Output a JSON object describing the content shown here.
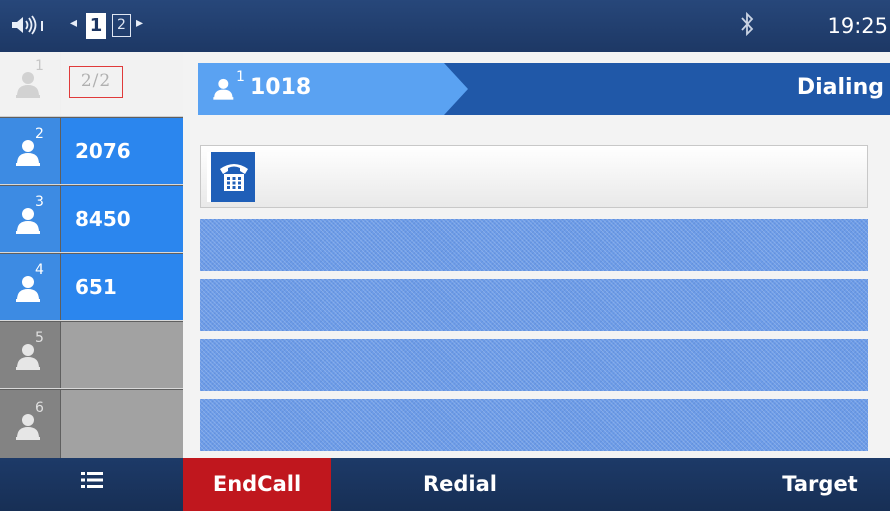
{
  "status_bar": {
    "page_current": "1",
    "page_next": "2",
    "clock": "19:25",
    "icons": [
      "volume-icon",
      "page-prev-icon",
      "page-next-icon",
      "bluetooth-icon"
    ]
  },
  "lines": {
    "counter": "2/2",
    "items": [
      {
        "index": "1",
        "number": "",
        "state": "idle"
      },
      {
        "index": "2",
        "number": "2076",
        "state": "active"
      },
      {
        "index": "3",
        "number": "8450",
        "state": "active"
      },
      {
        "index": "4",
        "number": "651",
        "state": "active"
      },
      {
        "index": "5",
        "number": "",
        "state": "unused"
      },
      {
        "index": "6",
        "number": "",
        "state": "unused"
      }
    ]
  },
  "call": {
    "line_index": "1",
    "number": "1018",
    "status": "Dialing",
    "dial_value": "",
    "icon": "phone-icon"
  },
  "softkeys": {
    "menu_icon": "menu-icon",
    "end_call": "EndCall",
    "redial": "Redial",
    "target": "Target"
  },
  "colors": {
    "active_line": "#2b86ee",
    "header_blue": "#2058a8",
    "end_call_red": "#c0171e",
    "status_bar": "#1d3865"
  }
}
